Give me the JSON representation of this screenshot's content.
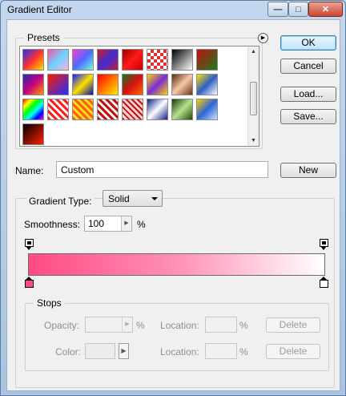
{
  "window": {
    "title": "Gradient Editor",
    "minimize_icon": "minimize-icon",
    "maximize_icon": "maximize-icon",
    "close_icon": "close-icon"
  },
  "presets": {
    "label": "Presets",
    "menu_icon": "right-arrow-circle-icon",
    "swatches": [
      {
        "bg": "linear-gradient(135deg,#1a34ff,#ff2f2f 50%,#ffe100)"
      },
      {
        "bg": "linear-gradient(135deg,#ff4fa0,#6ad4ff 50%,#ffb1e3)"
      },
      {
        "bg": "linear-gradient(135deg,#ff3ad0,#4c6bff 50%,#75ffd8)"
      },
      {
        "bg": "linear-gradient(135deg,#d21c1c,#3f2bd8 50%,#ba1f3f)"
      },
      {
        "bg": "linear-gradient(135deg,#9b0000,#ff1a1a 50%,#c80000)"
      },
      {
        "bg": "repeating-conic-gradient(#e03030 0 25%,#ffffff 0 50%) 0 0/8px 8px"
      },
      {
        "bg": "linear-gradient(135deg,#000,#fff)"
      },
      {
        "bg": "linear-gradient(135deg,#c01010,#1e7a1e)"
      },
      {
        "bg": "linear-gradient(135deg,#1e2fa8,#c8007f 50%,#ff9a00)"
      },
      {
        "bg": "linear-gradient(135deg,#ff1a00,#1f2fff)"
      },
      {
        "bg": "linear-gradient(135deg,#111bff,#ffe000 50%,#0010aa)"
      },
      {
        "bg": "linear-gradient(135deg,#ff0000,#ffea00)"
      },
      {
        "bg": "linear-gradient(135deg,#0b7a1d,#d41111 50%,#ff6600)"
      },
      {
        "bg": "linear-gradient(135deg,#ffd300,#7a2bd6 50%,#ffd300)"
      },
      {
        "bg": "linear-gradient(135deg,#5a2a0e,#f6c9a8 50%,#6e3314)"
      },
      {
        "bg": "linear-gradient(135deg,#ffe200,#2c5ec7 50%,#ffffff)"
      },
      {
        "bg": "linear-gradient(135deg,#ff0000,#ffff00 20%,#00ff00 40%,#00ffff 60%,#0000ff 80%,#ff00ff)"
      },
      {
        "bg": "repeating-linear-gradient(45deg,#ff1e1e 0 3px,#fff 3px 6px)"
      },
      {
        "bg": "repeating-linear-gradient(45deg,#ff5e10 0 3px,#ffe21a 3px 6px)"
      },
      {
        "bg": "repeating-linear-gradient(45deg,#c01010 0 3px,#ffffff 3px 6px)"
      },
      {
        "bg": "repeating-linear-gradient(45deg,#c01010 0 2px,#ffd1d1 2px 5px)"
      },
      {
        "bg": "linear-gradient(135deg,#0d1f8a,#ffffff 50%,#0d1f8a)"
      },
      {
        "bg": "linear-gradient(135deg,#133b0b,#b8e28a 50%,#244a12)"
      },
      {
        "bg": "linear-gradient(135deg,#ffd000,#2c66d9 50%,#cfe0ff)"
      },
      {
        "bg": "linear-gradient(135deg,#000000,#ff2000)"
      }
    ]
  },
  "buttons": {
    "ok": "OK",
    "cancel": "Cancel",
    "load": "Load...",
    "save": "Save...",
    "new": "New"
  },
  "name": {
    "label": "Name:",
    "value": "Custom"
  },
  "gradient": {
    "type_label": "Gradient Type:",
    "type_value": "Solid",
    "smoothness_label": "Smoothness:",
    "smoothness_value": "100",
    "smoothness_unit": "%",
    "colors": {
      "start": "#ff4a82",
      "mid": "#ff91b6",
      "end": "#ffffff"
    },
    "left_color_stop": "#ff4a82",
    "right_color_stop": "#ffffff"
  },
  "stops": {
    "label": "Stops",
    "opacity_label": "Opacity:",
    "opacity_unit": "%",
    "location_label": "Location:",
    "location_unit": "%",
    "delete_label": "Delete",
    "color_label": "Color:"
  }
}
